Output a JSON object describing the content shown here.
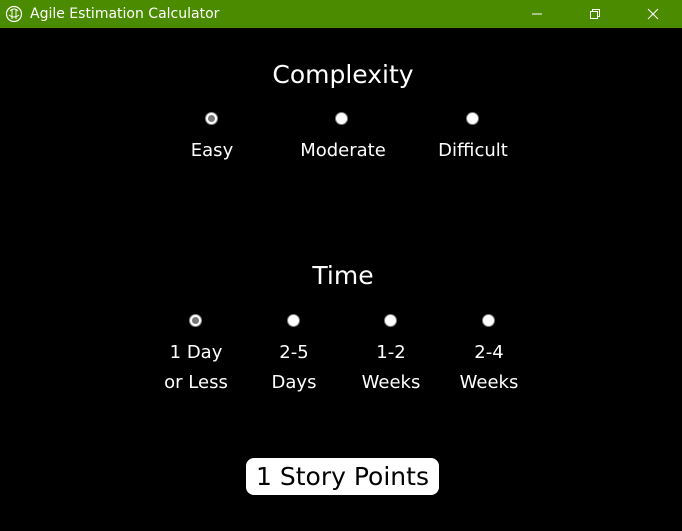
{
  "window": {
    "title": "Agile Estimation Calculator",
    "titlebar_color": "#4a8b00",
    "icon": "app-icon"
  },
  "controls": {
    "minimize_icon": "minimize-icon",
    "maximize_icon": "restore-icon",
    "close_icon": "close-icon"
  },
  "complexity": {
    "title": "Complexity",
    "options": [
      {
        "label": "Easy",
        "checked": true
      },
      {
        "label": "Moderate",
        "checked": false
      },
      {
        "label": "Difficult",
        "checked": false
      }
    ]
  },
  "time": {
    "title": "Time",
    "options": [
      {
        "line1": "1 Day",
        "line2": "or Less",
        "checked": true
      },
      {
        "line1": "2-5",
        "line2": "Days",
        "checked": false
      },
      {
        "line1": "1-2",
        "line2": "Weeks",
        "checked": false
      },
      {
        "line1": "2-4",
        "line2": "Weeks",
        "checked": false
      }
    ]
  },
  "result": {
    "text": "1 Story Points"
  }
}
